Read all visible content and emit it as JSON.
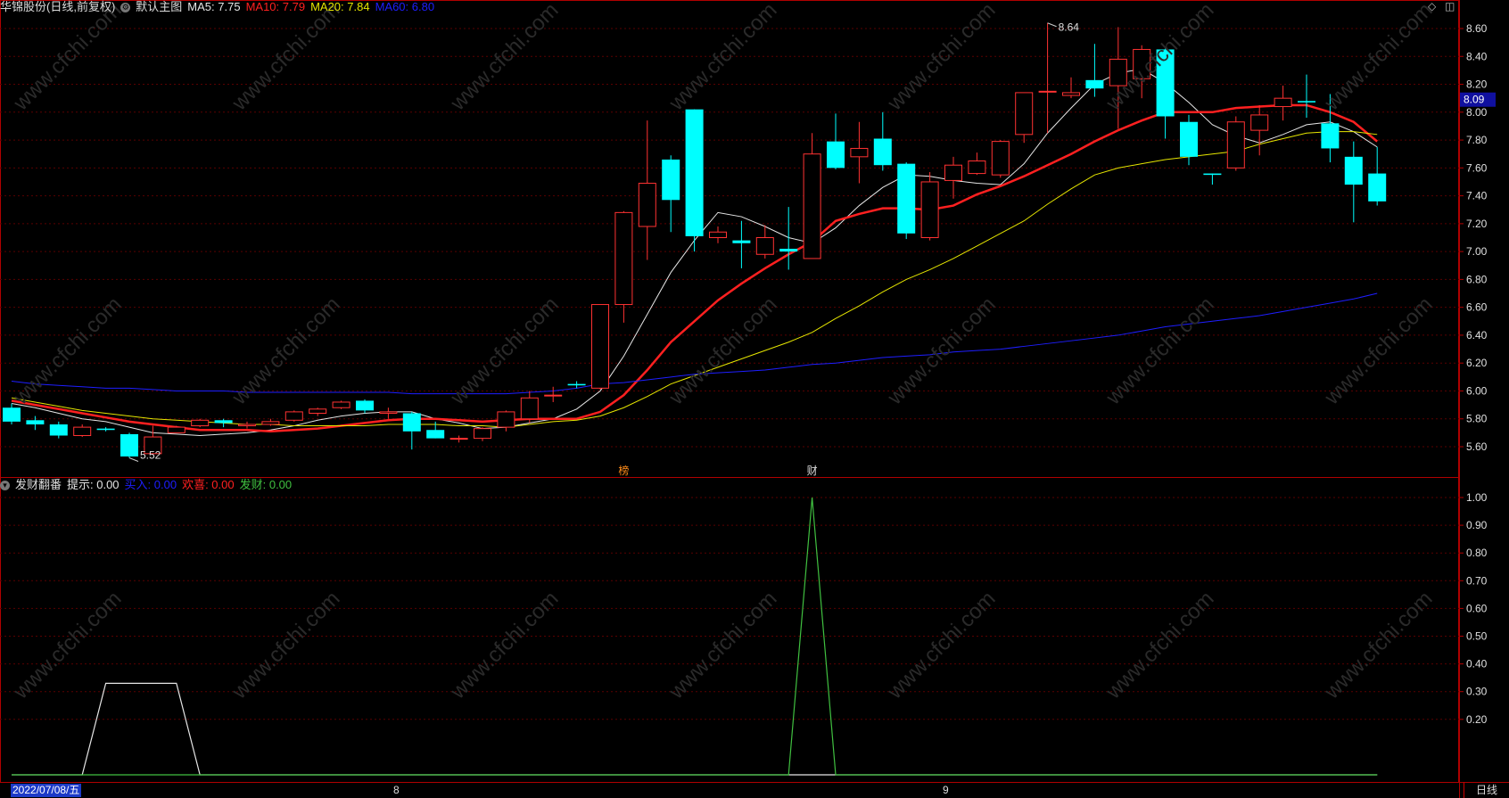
{
  "header": {
    "stock_title": "华锦股份(日线,前复权)",
    "chart_name": "默认主图",
    "ma": [
      {
        "label": "MA5: 7.75",
        "color": "#e6e6e6"
      },
      {
        "label": "MA10: 7.79",
        "color": "#ff2020"
      },
      {
        "label": "MA20: 7.84",
        "color": "#e6e600"
      },
      {
        "label": "MA60: 6.80",
        "color": "#1e1eff"
      }
    ]
  },
  "sub_header": {
    "indicator_name": "发财翻番",
    "items": [
      {
        "label": "提示: 0.00",
        "color": "#e6e6e6"
      },
      {
        "label": "买入: 0.00",
        "color": "#1e1eff"
      },
      {
        "label": "欢喜: 0.00",
        "color": "#ff2020"
      },
      {
        "label": "发财: 0.00",
        "color": "#40c040"
      }
    ]
  },
  "bottom": {
    "date": "2022/07/08/五",
    "month_marks": [
      "8",
      "9"
    ],
    "period_tab": "日线"
  },
  "corner_icons": [
    "diamond-icon",
    "square-icon"
  ],
  "chart_data": [
    {
      "type": "candlestick",
      "title": "华锦股份(日线,前复权)",
      "ylim": [
        5.4,
        8.75
      ],
      "yticks": [
        "8.60",
        "8.40",
        "8.20",
        "8.00",
        "7.80",
        "7.60",
        "7.40",
        "7.20",
        "7.00",
        "6.80",
        "6.60",
        "6.40",
        "6.20",
        "6.00",
        "5.80",
        "5.60"
      ],
      "current_price": "8.09",
      "annotations": [
        {
          "text": "8.64",
          "bar": 44,
          "price": 8.64
        },
        {
          "text": "5.52",
          "bar": 5,
          "price": 5.52
        }
      ],
      "markers": [
        {
          "text": "榜",
          "bar": 26,
          "color": "#ff8c1a"
        },
        {
          "text": "财",
          "bar": 34,
          "color": "#dddddd"
        }
      ],
      "candles": [
        {
          "o": 5.88,
          "h": 5.91,
          "c": 5.78,
          "l": 5.76
        },
        {
          "o": 5.79,
          "h": 5.82,
          "c": 5.76,
          "l": 5.72
        },
        {
          "o": 5.76,
          "h": 5.78,
          "c": 5.68,
          "l": 5.66
        },
        {
          "o": 5.68,
          "h": 5.76,
          "c": 5.74,
          "l": 5.67
        },
        {
          "o": 5.73,
          "h": 5.74,
          "c": 5.72,
          "l": 5.71
        },
        {
          "o": 5.69,
          "h": 5.7,
          "c": 5.53,
          "l": 5.52
        },
        {
          "o": 5.55,
          "h": 5.75,
          "c": 5.67,
          "l": 5.54
        },
        {
          "o": 5.7,
          "h": 5.75,
          "c": 5.74,
          "l": 5.7
        },
        {
          "o": 5.75,
          "h": 5.8,
          "c": 5.79,
          "l": 5.74
        },
        {
          "o": 5.79,
          "h": 5.8,
          "c": 5.77,
          "l": 5.74
        },
        {
          "o": 5.75,
          "h": 5.78,
          "c": 5.76,
          "l": 5.73
        },
        {
          "o": 5.76,
          "h": 5.8,
          "c": 5.78,
          "l": 5.75
        },
        {
          "o": 5.79,
          "h": 5.86,
          "c": 5.85,
          "l": 5.78
        },
        {
          "o": 5.84,
          "h": 5.88,
          "c": 5.87,
          "l": 5.82
        },
        {
          "o": 5.88,
          "h": 5.93,
          "c": 5.92,
          "l": 5.87
        },
        {
          "o": 5.93,
          "h": 5.94,
          "c": 5.86,
          "l": 5.84
        },
        {
          "o": 5.84,
          "h": 5.88,
          "c": 5.85,
          "l": 5.8
        },
        {
          "o": 5.84,
          "h": 5.85,
          "c": 5.71,
          "l": 5.58
        },
        {
          "o": 5.72,
          "h": 5.78,
          "c": 5.66,
          "l": 5.66
        },
        {
          "o": 5.66,
          "h": 5.68,
          "c": 5.66,
          "l": 5.63
        },
        {
          "o": 5.66,
          "h": 5.74,
          "c": 5.73,
          "l": 5.64
        },
        {
          "o": 5.74,
          "h": 5.86,
          "c": 5.85,
          "l": 5.71
        },
        {
          "o": 5.8,
          "h": 6.0,
          "c": 5.95,
          "l": 5.77
        },
        {
          "o": 5.97,
          "h": 6.03,
          "c": 5.97,
          "l": 5.92
        },
        {
          "o": 6.05,
          "h": 6.07,
          "c": 6.04,
          "l": 6.02
        },
        {
          "o": 6.02,
          "h": 6.62,
          "c": 6.62,
          "l": 6.01
        },
        {
          "o": 6.62,
          "h": 7.29,
          "c": 7.28,
          "l": 6.49
        },
        {
          "o": 7.18,
          "h": 7.94,
          "c": 7.49,
          "l": 6.94
        },
        {
          "o": 7.66,
          "h": 7.69,
          "c": 7.37,
          "l": 7.14
        },
        {
          "o": 8.02,
          "h": 8.02,
          "c": 7.11,
          "l": 7.0
        },
        {
          "o": 7.1,
          "h": 7.18,
          "c": 7.14,
          "l": 7.06
        },
        {
          "o": 7.08,
          "h": 7.22,
          "c": 7.06,
          "l": 6.88
        },
        {
          "o": 6.98,
          "h": 7.19,
          "c": 7.1,
          "l": 6.95
        },
        {
          "o": 7.02,
          "h": 7.32,
          "c": 7.0,
          "l": 6.87
        },
        {
          "o": 6.95,
          "h": 7.85,
          "c": 7.7,
          "l": 6.95
        },
        {
          "o": 7.79,
          "h": 7.99,
          "c": 7.6,
          "l": 7.59
        },
        {
          "o": 7.68,
          "h": 7.93,
          "c": 7.74,
          "l": 7.49
        },
        {
          "o": 7.81,
          "h": 8.0,
          "c": 7.62,
          "l": 7.58
        },
        {
          "o": 7.63,
          "h": 7.64,
          "c": 7.13,
          "l": 7.09
        },
        {
          "o": 7.1,
          "h": 7.57,
          "c": 7.5,
          "l": 7.08
        },
        {
          "o": 7.51,
          "h": 7.68,
          "c": 7.62,
          "l": 7.38
        },
        {
          "o": 7.56,
          "h": 7.71,
          "c": 7.65,
          "l": 7.55
        },
        {
          "o": 7.55,
          "h": 7.8,
          "c": 7.79,
          "l": 7.53
        },
        {
          "o": 7.84,
          "h": 7.91,
          "c": 8.14,
          "l": 7.78
        },
        {
          "o": 8.15,
          "h": 8.64,
          "c": 8.15,
          "l": 7.85
        },
        {
          "o": 8.12,
          "h": 8.25,
          "c": 8.14,
          "l": 8.1
        },
        {
          "o": 8.23,
          "h": 8.49,
          "c": 8.17,
          "l": 8.11
        },
        {
          "o": 8.19,
          "h": 8.61,
          "c": 8.38,
          "l": 7.88
        },
        {
          "o": 8.24,
          "h": 8.48,
          "c": 8.45,
          "l": 8.1
        },
        {
          "o": 8.45,
          "h": 8.47,
          "c": 7.97,
          "l": 7.81
        },
        {
          "o": 7.93,
          "h": 7.98,
          "c": 7.68,
          "l": 7.62
        },
        {
          "o": 7.56,
          "h": 7.56,
          "c": 7.55,
          "l": 7.48
        },
        {
          "o": 7.6,
          "h": 7.97,
          "c": 7.93,
          "l": 7.58
        },
        {
          "o": 7.87,
          "h": 8.05,
          "c": 7.98,
          "l": 7.69
        },
        {
          "o": 8.04,
          "h": 8.19,
          "c": 8.1,
          "l": 7.94
        },
        {
          "o": 8.08,
          "h": 8.27,
          "c": 8.07,
          "l": 7.96
        },
        {
          "o": 7.92,
          "h": 8.13,
          "c": 7.74,
          "l": 7.64
        },
        {
          "o": 7.68,
          "h": 7.79,
          "c": 7.48,
          "l": 7.21
        },
        {
          "o": 7.56,
          "h": 7.75,
          "c": 7.36,
          "l": 7.33
        }
      ],
      "series": [
        {
          "name": "MA5",
          "color": "#e6e6e6",
          "width": 1,
          "values": [
            5.91,
            5.88,
            5.84,
            5.8,
            5.78,
            5.74,
            5.7,
            5.69,
            5.68,
            5.69,
            5.7,
            5.72,
            5.75,
            5.79,
            5.82,
            5.84,
            5.85,
            5.85,
            5.8,
            5.77,
            5.73,
            5.74,
            5.77,
            5.8,
            5.87,
            6.0,
            6.25,
            6.55,
            6.85,
            7.08,
            7.28,
            7.25,
            7.18,
            7.1,
            7.06,
            7.17,
            7.33,
            7.46,
            7.55,
            7.54,
            7.51,
            7.49,
            7.48,
            7.63,
            7.85,
            8.03,
            8.2,
            8.28,
            8.31,
            8.21,
            8.07,
            7.91,
            7.83,
            7.78,
            7.84,
            7.91,
            7.93,
            7.86,
            7.75
          ]
        },
        {
          "name": "MA10",
          "color": "#ff2020",
          "width": 2.5,
          "values": [
            5.93,
            5.9,
            5.87,
            5.84,
            5.81,
            5.78,
            5.76,
            5.74,
            5.72,
            5.72,
            5.72,
            5.71,
            5.72,
            5.73,
            5.75,
            5.77,
            5.79,
            5.8,
            5.8,
            5.79,
            5.78,
            5.79,
            5.8,
            5.8,
            5.8,
            5.85,
            5.97,
            6.15,
            6.35,
            6.5,
            6.65,
            6.77,
            6.88,
            6.98,
            7.07,
            7.22,
            7.27,
            7.31,
            7.31,
            7.3,
            7.33,
            7.41,
            7.47,
            7.54,
            7.62,
            7.7,
            7.79,
            7.87,
            7.94,
            8.0,
            8.0,
            8.0,
            8.03,
            8.04,
            8.05,
            8.05,
            8.0,
            7.93,
            7.79
          ]
        },
        {
          "name": "MA20",
          "color": "#e6e600",
          "width": 1,
          "values": [
            5.95,
            5.92,
            5.89,
            5.86,
            5.84,
            5.82,
            5.8,
            5.79,
            5.78,
            5.77,
            5.76,
            5.76,
            5.75,
            5.75,
            5.75,
            5.75,
            5.76,
            5.76,
            5.76,
            5.75,
            5.75,
            5.74,
            5.76,
            5.78,
            5.79,
            5.82,
            5.88,
            5.96,
            6.05,
            6.11,
            6.17,
            6.23,
            6.29,
            6.35,
            6.42,
            6.52,
            6.61,
            6.71,
            6.8,
            6.87,
            6.95,
            7.04,
            7.13,
            7.22,
            7.34,
            7.45,
            7.55,
            7.6,
            7.63,
            7.66,
            7.68,
            7.7,
            7.72,
            7.77,
            7.81,
            7.85,
            7.86,
            7.86,
            7.84
          ]
        },
        {
          "name": "MA60",
          "color": "#1e1eff",
          "width": 1,
          "values": [
            6.07,
            6.05,
            6.04,
            6.03,
            6.02,
            6.02,
            6.01,
            6.0,
            6.0,
            6.0,
            5.99,
            5.99,
            5.99,
            5.99,
            5.99,
            5.99,
            5.99,
            5.98,
            5.98,
            5.98,
            5.98,
            5.98,
            5.99,
            6.0,
            6.02,
            6.05,
            6.06,
            6.08,
            6.1,
            6.12,
            6.13,
            6.14,
            6.15,
            6.17,
            6.19,
            6.2,
            6.22,
            6.24,
            6.25,
            6.26,
            6.28,
            6.29,
            6.3,
            6.32,
            6.34,
            6.36,
            6.38,
            6.4,
            6.43,
            6.46,
            6.48,
            6.5,
            6.52,
            6.54,
            6.57,
            6.6,
            6.63,
            6.66,
            6.7,
            6.73,
            6.76,
            6.78,
            6.8
          ]
        }
      ]
    },
    {
      "type": "line",
      "title": "发财翻番",
      "ylim": [
        0,
        1.05
      ],
      "yticks": [
        "1.00",
        "0.90",
        "0.80",
        "0.70",
        "0.60",
        "0.50",
        "0.40",
        "0.30",
        "0.20"
      ],
      "series": [
        {
          "name": "提示",
          "color": "#e6e6e6",
          "values": [
            0,
            0,
            0,
            0,
            0.33,
            0.33,
            0.33,
            0.33,
            0,
            0,
            0,
            0,
            0,
            0,
            0,
            0,
            0,
            0,
            0,
            0,
            0,
            0,
            0,
            0,
            0,
            0,
            0,
            0,
            0,
            0,
            0,
            0,
            0,
            0,
            0,
            0,
            0,
            0,
            0,
            0,
            0,
            0,
            0,
            0,
            0,
            0,
            0,
            0,
            0,
            0,
            0,
            0,
            0,
            0,
            0,
            0,
            0,
            0,
            0
          ]
        },
        {
          "name": "发财",
          "color": "#40c040",
          "values": [
            0,
            0,
            0,
            0,
            0,
            0,
            0,
            0,
            0,
            0,
            0,
            0,
            0,
            0,
            0,
            0,
            0,
            0,
            0,
            0,
            0,
            0,
            0,
            0,
            0,
            0,
            0,
            0,
            0,
            0,
            0,
            0,
            0,
            0,
            1,
            0,
            0,
            0,
            0,
            0,
            0,
            0,
            0,
            0,
            0,
            0,
            0,
            0,
            0,
            0,
            0,
            0,
            0,
            0,
            0,
            0,
            0,
            0,
            0
          ]
        }
      ]
    }
  ]
}
